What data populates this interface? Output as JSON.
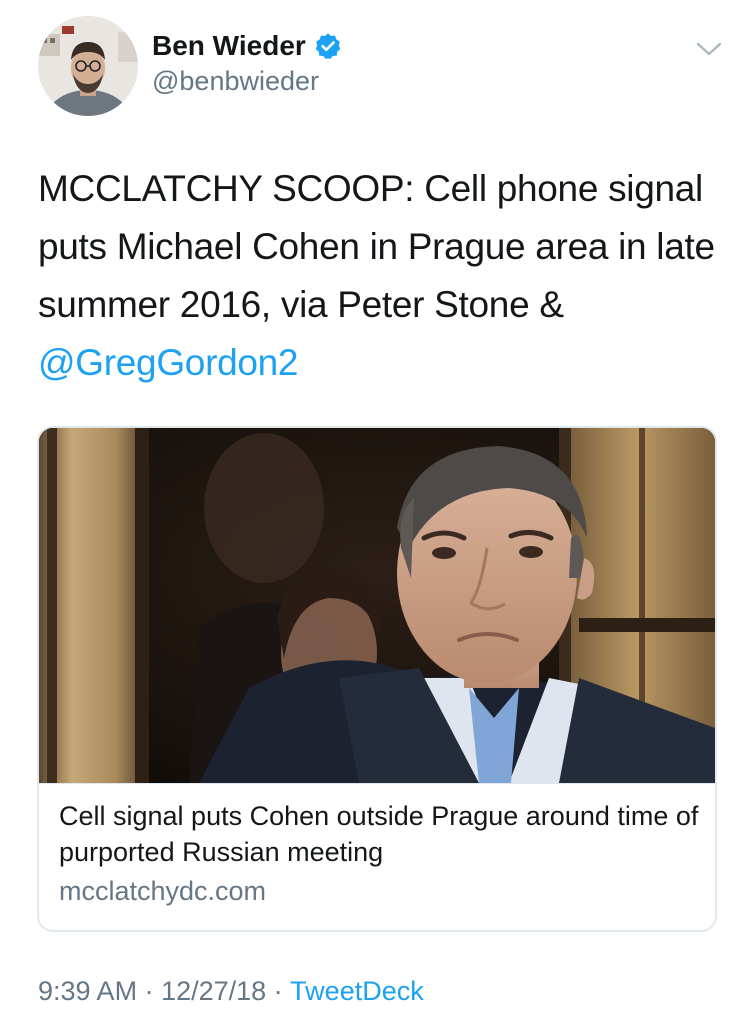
{
  "author": {
    "display_name": "Ben Wieder",
    "handle": "@benbwieder",
    "verified": true
  },
  "tweet": {
    "text_plain": "MCCLATCHY SCOOP: Cell phone signal puts Michael Cohen in Prague area in late summer 2016, via Peter Stone & ",
    "mention": "@GregGordon2"
  },
  "link_card": {
    "title": "Cell signal puts Cohen outside Prague around time of purported Russian meeting",
    "domain": "mcclatchydc.com"
  },
  "meta": {
    "time": "9:39 AM",
    "sep1": " · ",
    "date": "12/27/18",
    "sep2": " · ",
    "source": "TweetDeck"
  },
  "colors": {
    "link_blue": "#1da1f2",
    "secondary_text": "#657786",
    "primary_text": "#14171a",
    "border": "#e1e8ed"
  },
  "icons": {
    "verified": "verified-badge-icon",
    "menu": "chevron-down-icon"
  }
}
